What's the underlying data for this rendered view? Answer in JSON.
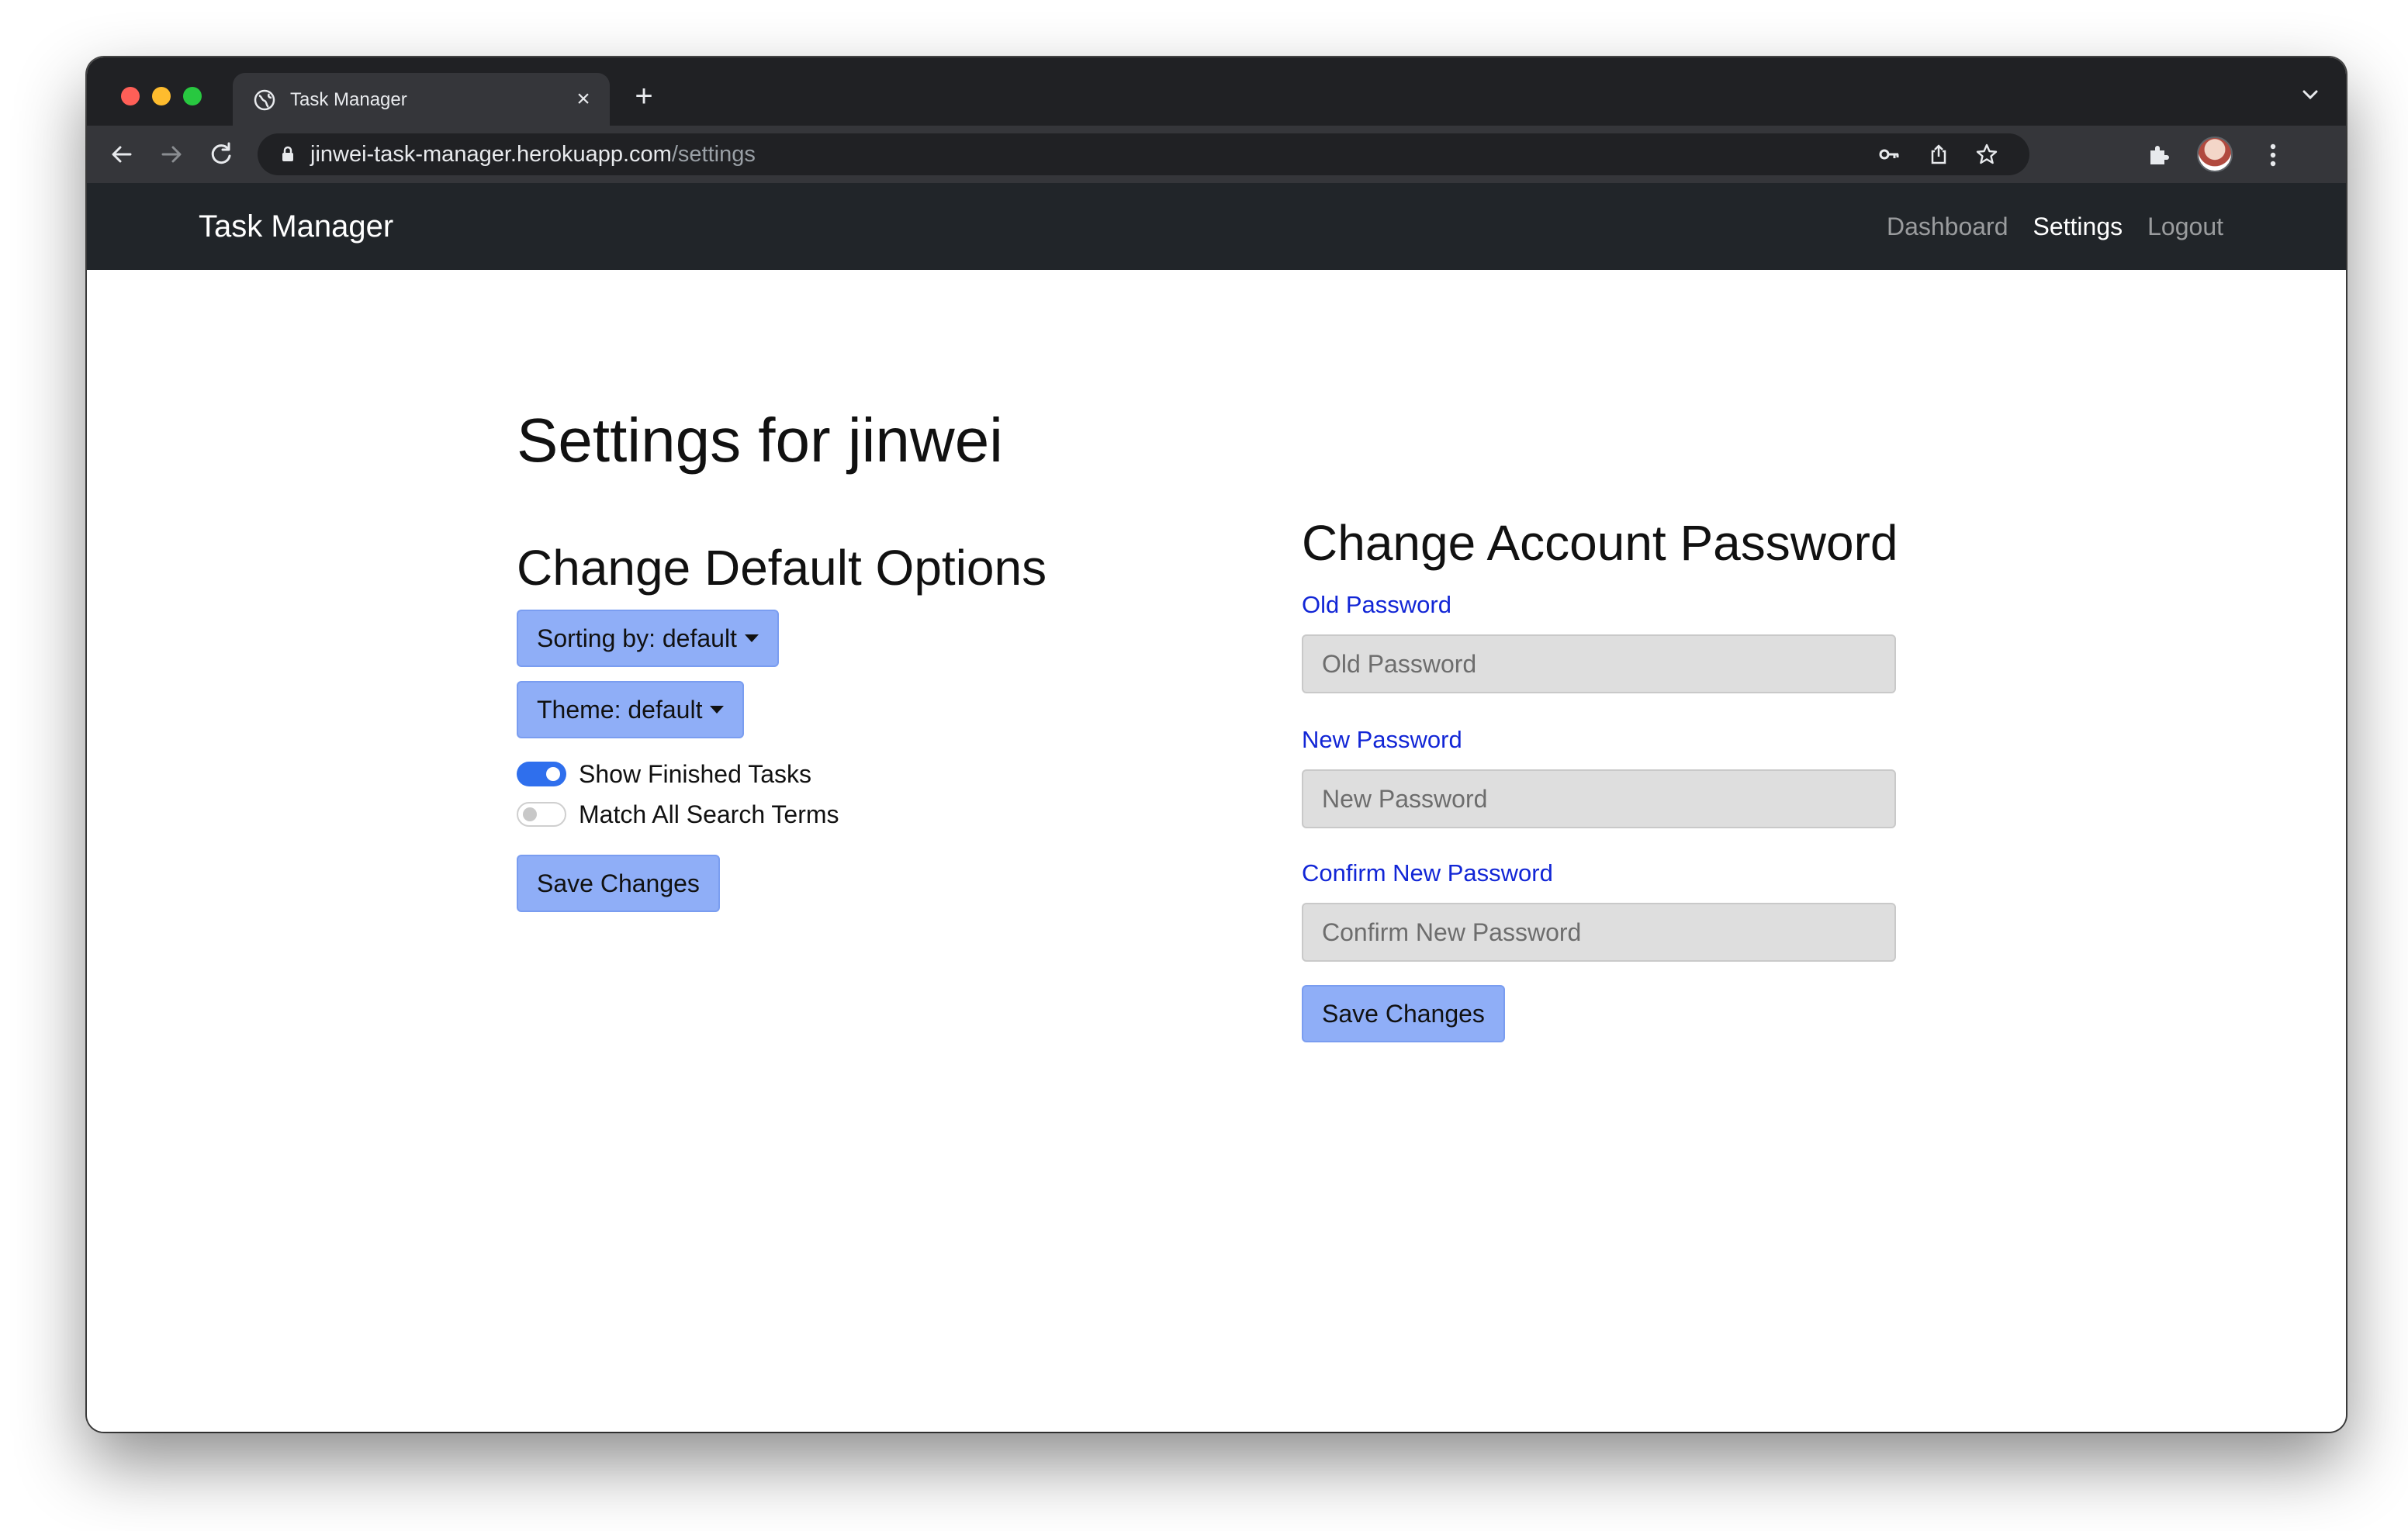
{
  "browser": {
    "tab_title": "Task Manager",
    "tab_close_glyph": "×",
    "new_tab_glyph": "+",
    "url_host": "jinwei-task-manager.herokuapp.com",
    "url_path": "/settings"
  },
  "navbar": {
    "brand": "Task Manager",
    "links": [
      {
        "label": "Dashboard",
        "active": false
      },
      {
        "label": "Settings",
        "active": true
      },
      {
        "label": "Logout",
        "active": false
      }
    ]
  },
  "page": {
    "title": "Settings for jinwei"
  },
  "defaults": {
    "title": "Change Default Options",
    "sorting_button": "Sorting by: default",
    "theme_button": "Theme: default",
    "toggles": [
      {
        "label": "Show Finished Tasks",
        "checked": true
      },
      {
        "label": "Match All Search Terms",
        "checked": false
      }
    ],
    "save_label": "Save Changes"
  },
  "password": {
    "title": "Change Account Password",
    "old_label": "Old Password",
    "old_placeholder": "Old Password",
    "new_label": "New Password",
    "new_placeholder": "New Password",
    "confirm_label": "Confirm New Password",
    "confirm_placeholder": "Confirm New Password",
    "save_label": "Save Changes"
  },
  "colors": {
    "navbar_bg": "#212529",
    "button_bg": "#8faef7",
    "label_blue": "#1226d6",
    "switch_on": "#2f6fed"
  }
}
